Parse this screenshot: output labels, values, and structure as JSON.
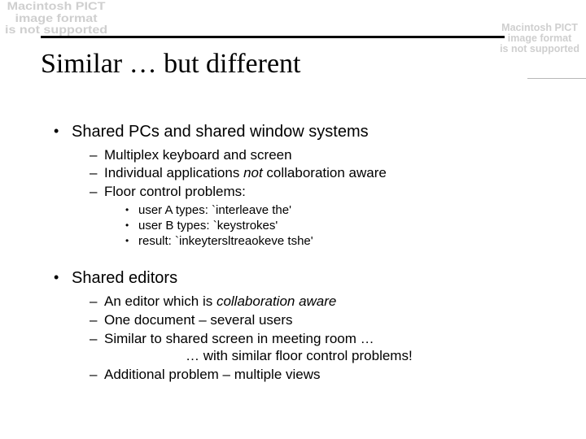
{
  "warnings": {
    "left": "Macintosh PICT\nimage format\nis not supported",
    "right": "Macintosh PICT\nimage format\nis not supported"
  },
  "title": "Similar … but different",
  "sections": [
    {
      "heading": "Shared PCs and shared window systems",
      "sub": [
        {
          "text": "Multiplex keyboard and screen"
        },
        {
          "prefix": "Individual applications ",
          "em": "not",
          "suffix": " collaboration aware"
        },
        {
          "text": "Floor control problems:"
        }
      ],
      "subsub": [
        "user A types: `interleave the'",
        "user B types: `keystrokes'",
        "result: `inkeytersltreaokeve tshe'"
      ]
    },
    {
      "heading": "Shared editors",
      "sub": [
        {
          "prefix": "An editor which is ",
          "em": "collaboration aware",
          "suffix": ""
        },
        {
          "text": "One document – several users"
        },
        {
          "text": "Similar to shared screen in meeting room …",
          "cont": "… with similar floor control problems!"
        },
        {
          "text": "Additional problem – multiple views"
        }
      ]
    }
  ]
}
